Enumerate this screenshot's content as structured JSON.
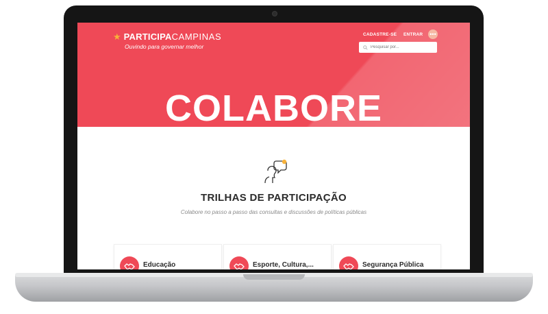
{
  "brand": {
    "name_bold": "PARTICIPA",
    "name_light": "CAMPINAS",
    "tagline": "Ouvindo para governar melhor",
    "accent_color": "#ef4957",
    "star_color": "#f7b23a"
  },
  "header": {
    "signup_label": "CADASTRE-SE",
    "login_label": "ENTRAR",
    "menu_icon": "more-dots-icon",
    "search": {
      "placeholder": "Pesquisar por..."
    }
  },
  "hero": {
    "title": "COLABORE"
  },
  "section": {
    "icon": "chat-person-icon",
    "title": "TRILHAS DE PARTICIPAÇÃO",
    "subtitle": "Colabore no passo a passo das consultas e discussões de políticas públicas"
  },
  "cards": [
    {
      "label": "Educação",
      "icon": "handshake-icon"
    },
    {
      "label": "Esporte, Cultura,...",
      "icon": "handshake-icon"
    },
    {
      "label": "Segurança Pública",
      "icon": "handshake-icon"
    }
  ]
}
